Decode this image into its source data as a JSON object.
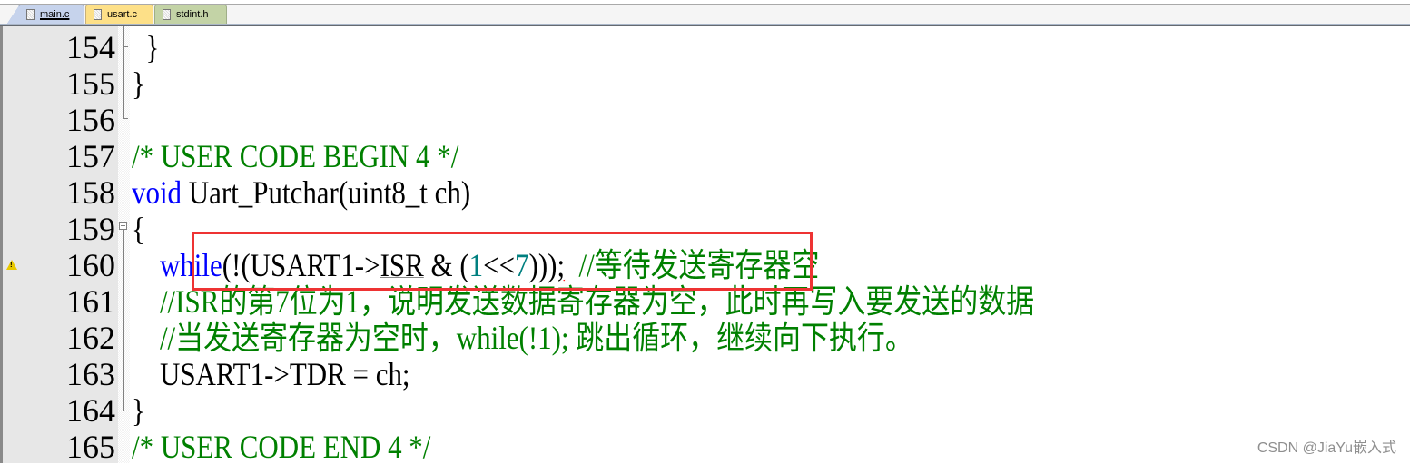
{
  "tabs": [
    {
      "label": "main.c",
      "active": true,
      "color": "#c6d3ec"
    },
    {
      "label": "usart.c",
      "active": false,
      "color": "#fde088"
    },
    {
      "label": "stdint.h",
      "active": false,
      "color": "#c3d3a6"
    }
  ],
  "colors": {
    "keyword": "#0000ff",
    "comment": "#008000",
    "number": "#008080",
    "highlight_box": "#ee3333"
  },
  "lines": [
    {
      "num": "154",
      "indent": "  ",
      "segments": [
        {
          "t": "}",
          "c": ""
        }
      ]
    },
    {
      "num": "155",
      "indent": "",
      "segments": [
        {
          "t": "}",
          "c": ""
        }
      ]
    },
    {
      "num": "156",
      "indent": "",
      "segments": []
    },
    {
      "num": "157",
      "indent": "",
      "segments": [
        {
          "t": "/* USER CODE BEGIN 4 */",
          "c": "cm"
        }
      ]
    },
    {
      "num": "158",
      "indent": "",
      "segments": [
        {
          "t": "void",
          "c": "kw"
        },
        {
          "t": " Uart_Putchar(uint8_t ch)",
          "c": ""
        }
      ]
    },
    {
      "num": "159",
      "indent": "",
      "segments": [
        {
          "t": "{",
          "c": ""
        }
      ]
    },
    {
      "num": "160",
      "indent": "    ",
      "segments": [
        {
          "t": "while",
          "c": "kw"
        },
        {
          "t": "(!(USART1->",
          "c": ""
        },
        {
          "t": "ISR",
          "c": "ul"
        },
        {
          "t": " & (",
          "c": ""
        },
        {
          "t": "1",
          "c": "num"
        },
        {
          "t": "<<",
          "c": ""
        },
        {
          "t": "7",
          "c": "num"
        },
        {
          "t": ")))",
          "c": ""
        },
        {
          "t": ";",
          "c": "squiggle"
        },
        {
          "t": "  //等待发送寄存器空",
          "c": "cm"
        }
      ]
    },
    {
      "num": "161",
      "indent": "    ",
      "segments": [
        {
          "t": "//ISR的第7位为1，说明发送数据寄存器为空，此时再写入要发送的数据",
          "c": "cm"
        }
      ]
    },
    {
      "num": "162",
      "indent": "    ",
      "segments": [
        {
          "t": "//当发送寄存器为空时，while(!1); 跳出循环，继续向下执行。",
          "c": "cm"
        }
      ]
    },
    {
      "num": "163",
      "indent": "    ",
      "segments": [
        {
          "t": "USART1->TDR = ch;",
          "c": ""
        }
      ]
    },
    {
      "num": "164",
      "indent": "",
      "segments": [
        {
          "t": "}",
          "c": ""
        }
      ]
    },
    {
      "num": "165",
      "indent": "",
      "segments": [
        {
          "t": "/* USER CODE END 4 */",
          "c": "cm"
        }
      ]
    }
  ],
  "warning_line": "160",
  "watermark": "CSDN @JiaYu嵌入式"
}
